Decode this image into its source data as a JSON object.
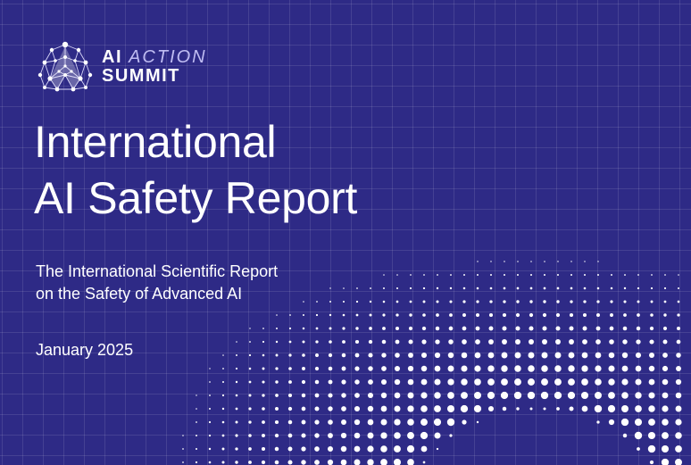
{
  "logo": {
    "line1_prefix": "AI",
    "line1_accent": "ACTION",
    "line2": "SUMMIT",
    "mark_icon": "network-nodes-a-icon"
  },
  "title": {
    "line1": "International",
    "line2": "AI Safety Report"
  },
  "subtitle": {
    "line1": "The International Scientific Report",
    "line2": "on the Safety of Advanced AI"
  },
  "date": "January 2025",
  "colors": {
    "background": "#2e2a86",
    "text": "#ffffff",
    "logo_accent": "#bfbcf2"
  }
}
